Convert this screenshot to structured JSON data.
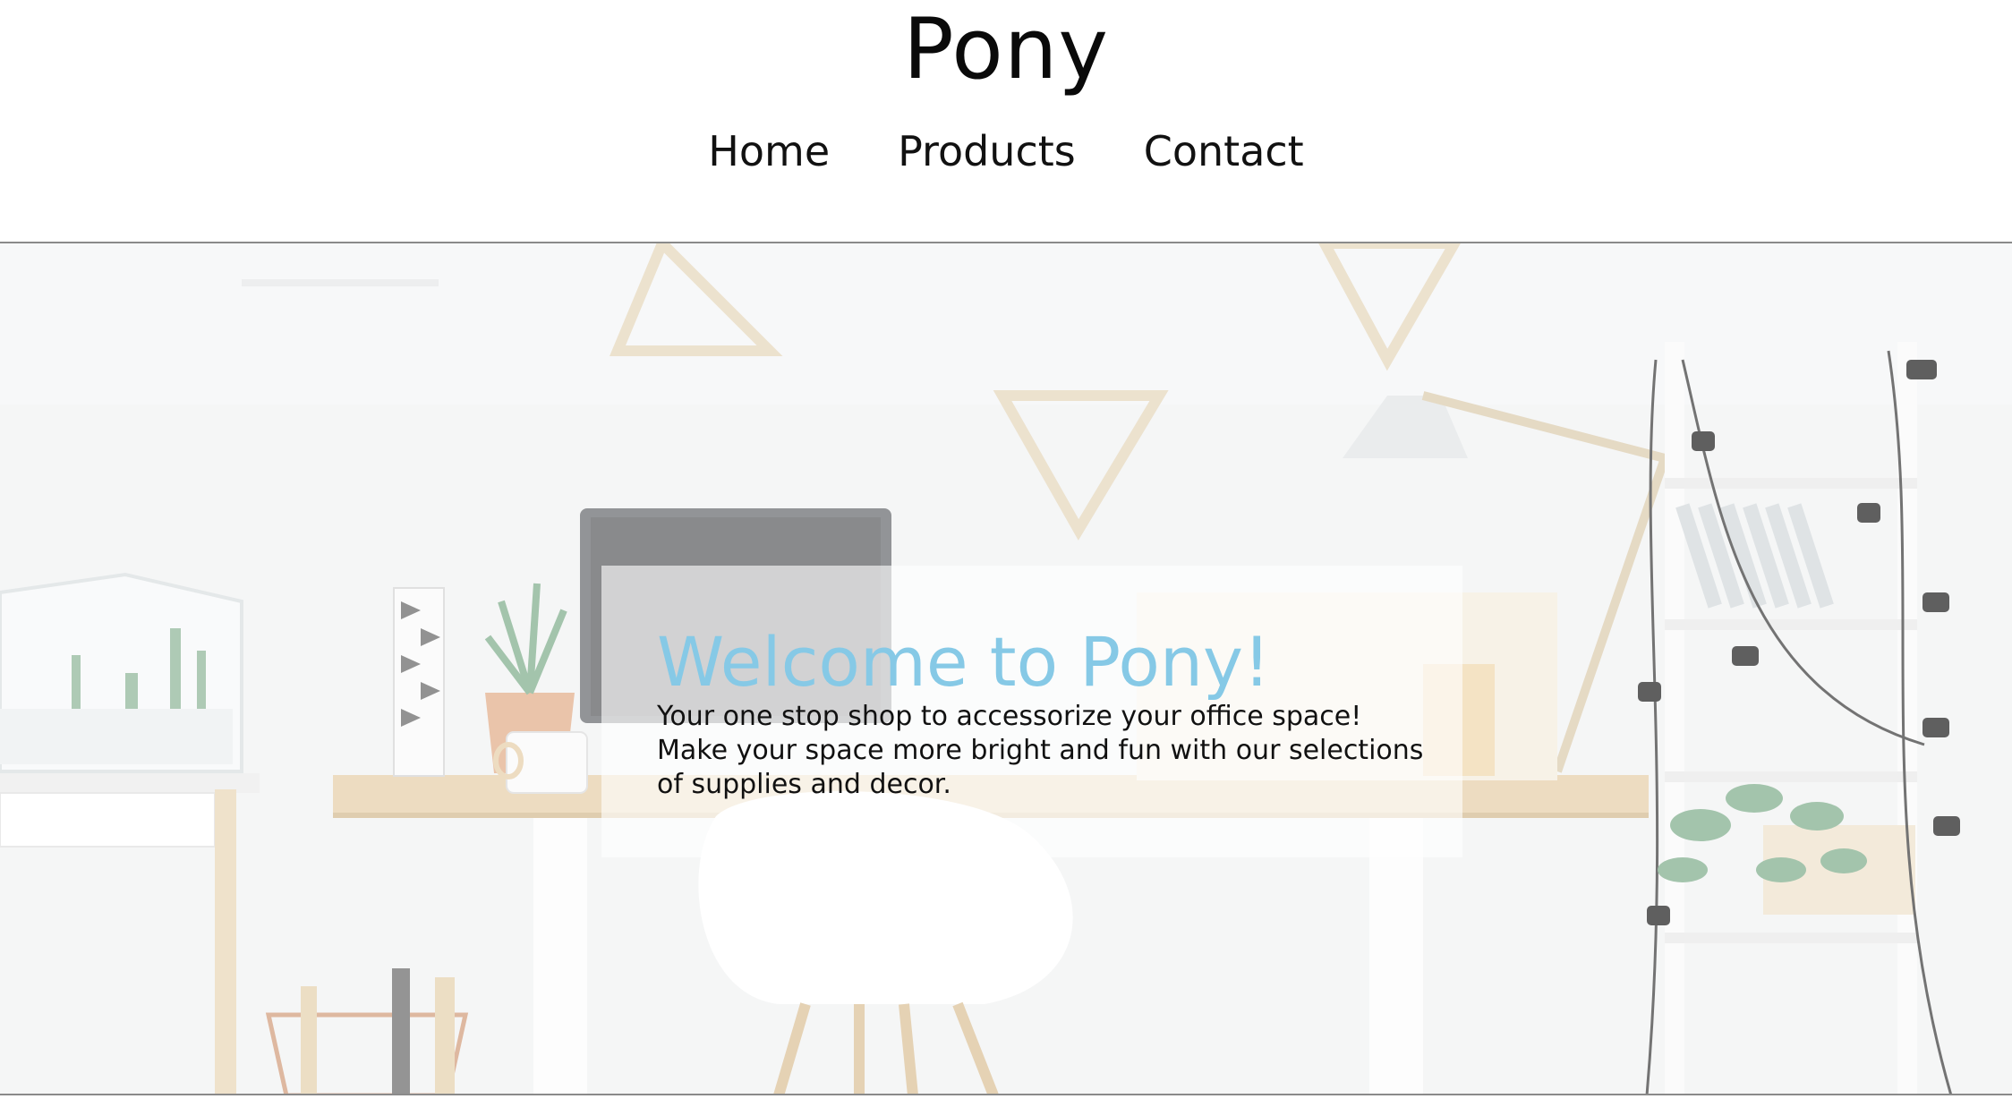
{
  "header": {
    "brand": "Pony",
    "nav": [
      {
        "label": "Home"
      },
      {
        "label": "Products"
      },
      {
        "label": "Contact"
      }
    ]
  },
  "hero": {
    "title": "Welcome to Pony!",
    "lines": [
      "Your one stop shop to accessorize your office space!",
      "Make your space more bright and fun with our selections",
      "of supplies and decor."
    ]
  },
  "colors": {
    "title_accent": "#86c9e6",
    "text": "#111111",
    "divider": "#8a8a8a"
  }
}
